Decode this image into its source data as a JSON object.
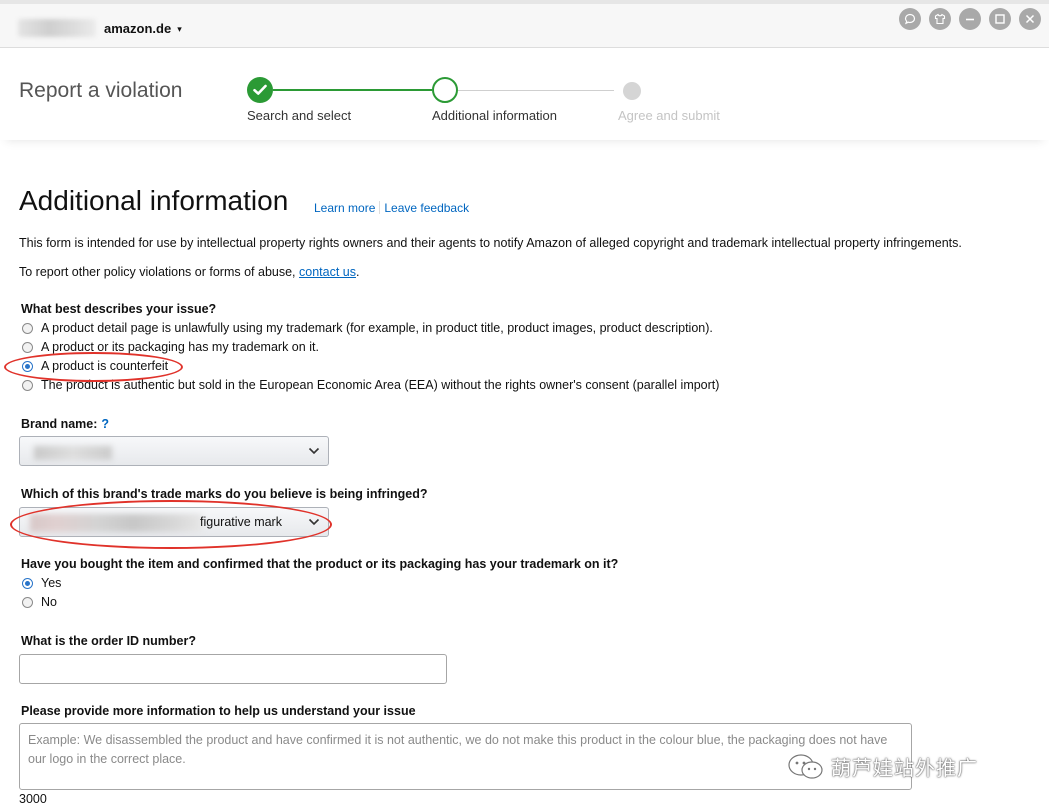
{
  "topbar": {
    "marketplace": "amazon.de",
    "marketplace_caret": "▾",
    "window_buttons": [
      "chat-icon",
      "shirt-icon",
      "minimize-icon",
      "maximize-icon",
      "close-icon"
    ]
  },
  "stepper": {
    "title": "Report a violation",
    "steps": [
      {
        "label": "Search and select",
        "state": "complete"
      },
      {
        "label": "Additional information",
        "state": "current"
      },
      {
        "label": "Agree and submit",
        "state": "pending"
      }
    ],
    "accent_color": "#2b9a35"
  },
  "content": {
    "heading": "Additional information",
    "learn_more": "Learn more",
    "leave_feedback": "Leave feedback",
    "intro_text": "This form is intended for use by intellectual property rights owners and their agents to notify Amazon of alleged copyright and trademark intellectual property infringements.",
    "intro2_prefix": "To report other policy violations or forms of abuse, ",
    "intro2_link": "contact us",
    "intro2_suffix": ".",
    "issue": {
      "label": "What best describes your issue?",
      "options": [
        {
          "label": "A product detail page is unlawfully using my trademark (for example, in product title, product images, product description).",
          "checked": false
        },
        {
          "label": "A product or its packaging has my trademark on it.",
          "checked": false
        },
        {
          "label": "A product is counterfeit",
          "checked": true
        },
        {
          "label": "The product is authentic but sold in the European Economic Area (EEA) without the rights owner's consent (parallel import)",
          "checked": false
        }
      ]
    },
    "brand": {
      "label": "Brand name:",
      "help": "?"
    },
    "trademark": {
      "label": "Which of this brand's trade marks do you believe is being infringed?",
      "selected_visible": "figurative mark"
    },
    "bought": {
      "label": "Have you bought the item and confirmed that the product or its packaging has your trademark on it?",
      "options": [
        {
          "label": "Yes",
          "checked": true
        },
        {
          "label": "No",
          "checked": false
        }
      ]
    },
    "order": {
      "label": "What is the order ID number?",
      "value": ""
    },
    "more_info": {
      "label": "Please provide more information to help us understand your issue",
      "placeholder": "Example: We disassembled the product and have confirmed it is not authentic, we do not make this product in the colour blue, the packaging does not have our logo in the correct place.",
      "char_count": "3000"
    }
  },
  "annotation_color": "#e0322a",
  "watermark": {
    "text": "葫芦娃站外推广",
    "icon": "wechat-icon"
  }
}
